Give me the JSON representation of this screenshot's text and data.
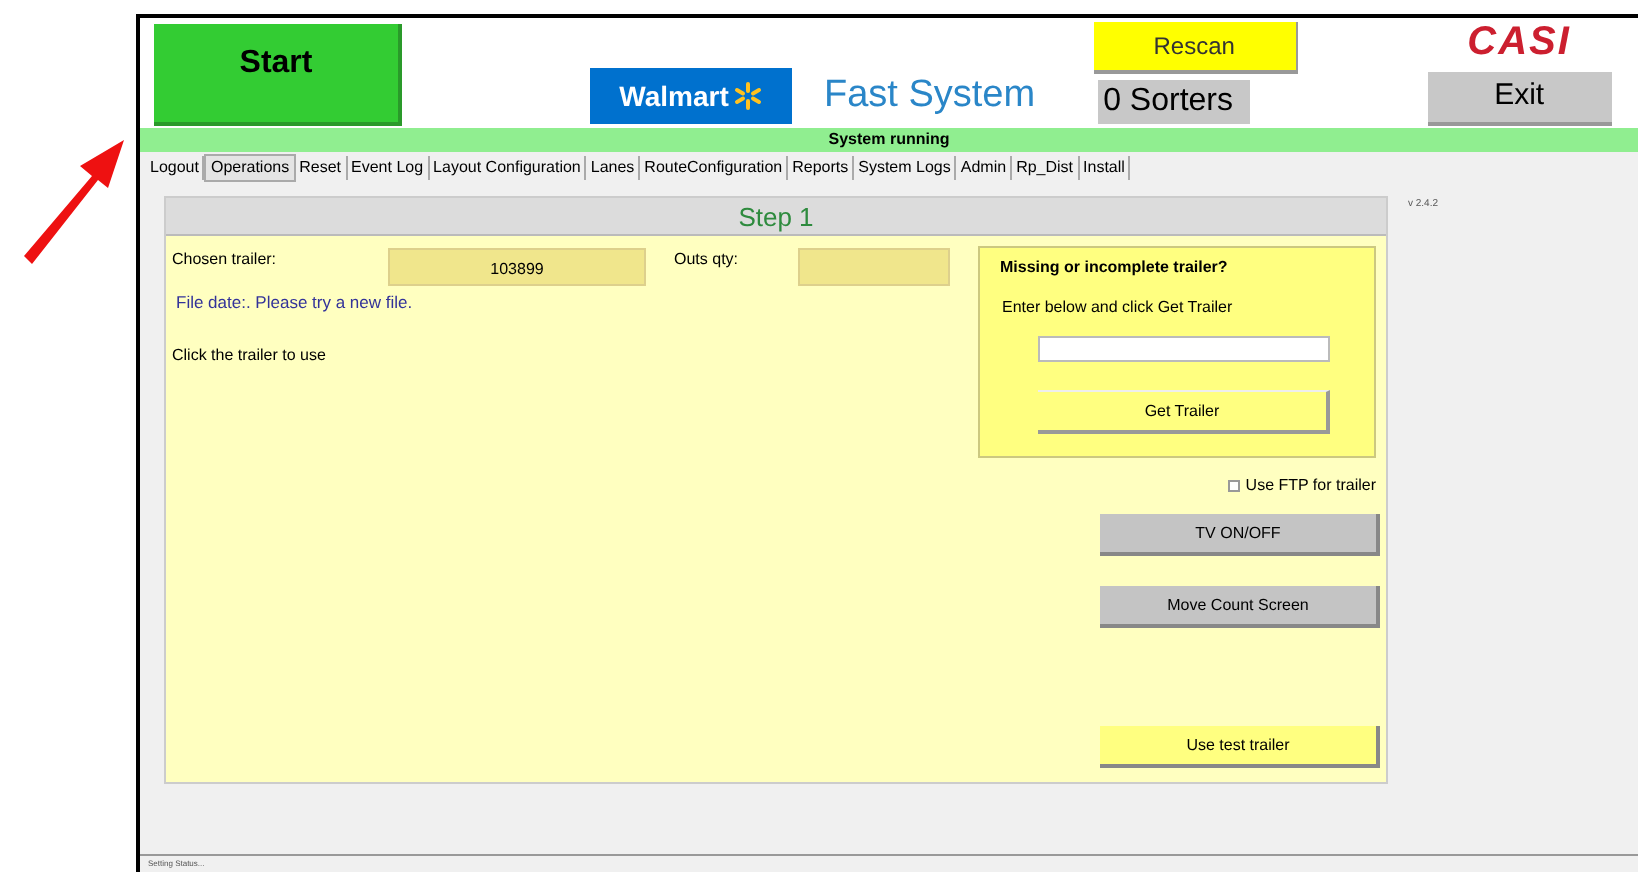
{
  "header": {
    "start_button": "Start",
    "logo_text": "Walmart",
    "app_title": "Fast System",
    "rescan_button": "Rescan",
    "sorters": "0 Sorters",
    "brand": "CASI",
    "exit_button": "Exit"
  },
  "status": "System running",
  "tabs": [
    {
      "label": "Logout",
      "selected": false
    },
    {
      "label": "Operations",
      "selected": true
    },
    {
      "label": "Reset",
      "selected": false
    },
    {
      "label": "Event Log",
      "selected": false
    },
    {
      "label": "Layout Configuration",
      "selected": false
    },
    {
      "label": "Lanes",
      "selected": false
    },
    {
      "label": "RouteConfiguration",
      "selected": false
    },
    {
      "label": "Reports",
      "selected": false
    },
    {
      "label": "System Logs",
      "selected": false
    },
    {
      "label": "Admin",
      "selected": false
    },
    {
      "label": "Rp_Dist",
      "selected": false
    },
    {
      "label": "Install",
      "selected": false
    }
  ],
  "step": {
    "title": "Step 1",
    "chosen_trailer_label": "Chosen trailer:",
    "chosen_trailer_value": "103899",
    "outs_qty_label": "Outs qty:",
    "file_message": "File date:. Please try a new file.",
    "instruction": "Click the trailer to use",
    "missing": {
      "title": "Missing or incomplete trailer?",
      "hint": "Enter below and click Get Trailer",
      "button": "Get Trailer"
    },
    "use_ftp": {
      "label": "Use FTP for trailer",
      "checked": false
    },
    "buttons": [
      {
        "label": "TV ON/OFF",
        "kind": "gray"
      },
      {
        "label": "Move Count Screen",
        "kind": "gray"
      },
      {
        "label": "Use test trailer",
        "kind": "yellow"
      }
    ]
  },
  "version": "v 2.4.2",
  "status_bar": "Setting Status..."
}
